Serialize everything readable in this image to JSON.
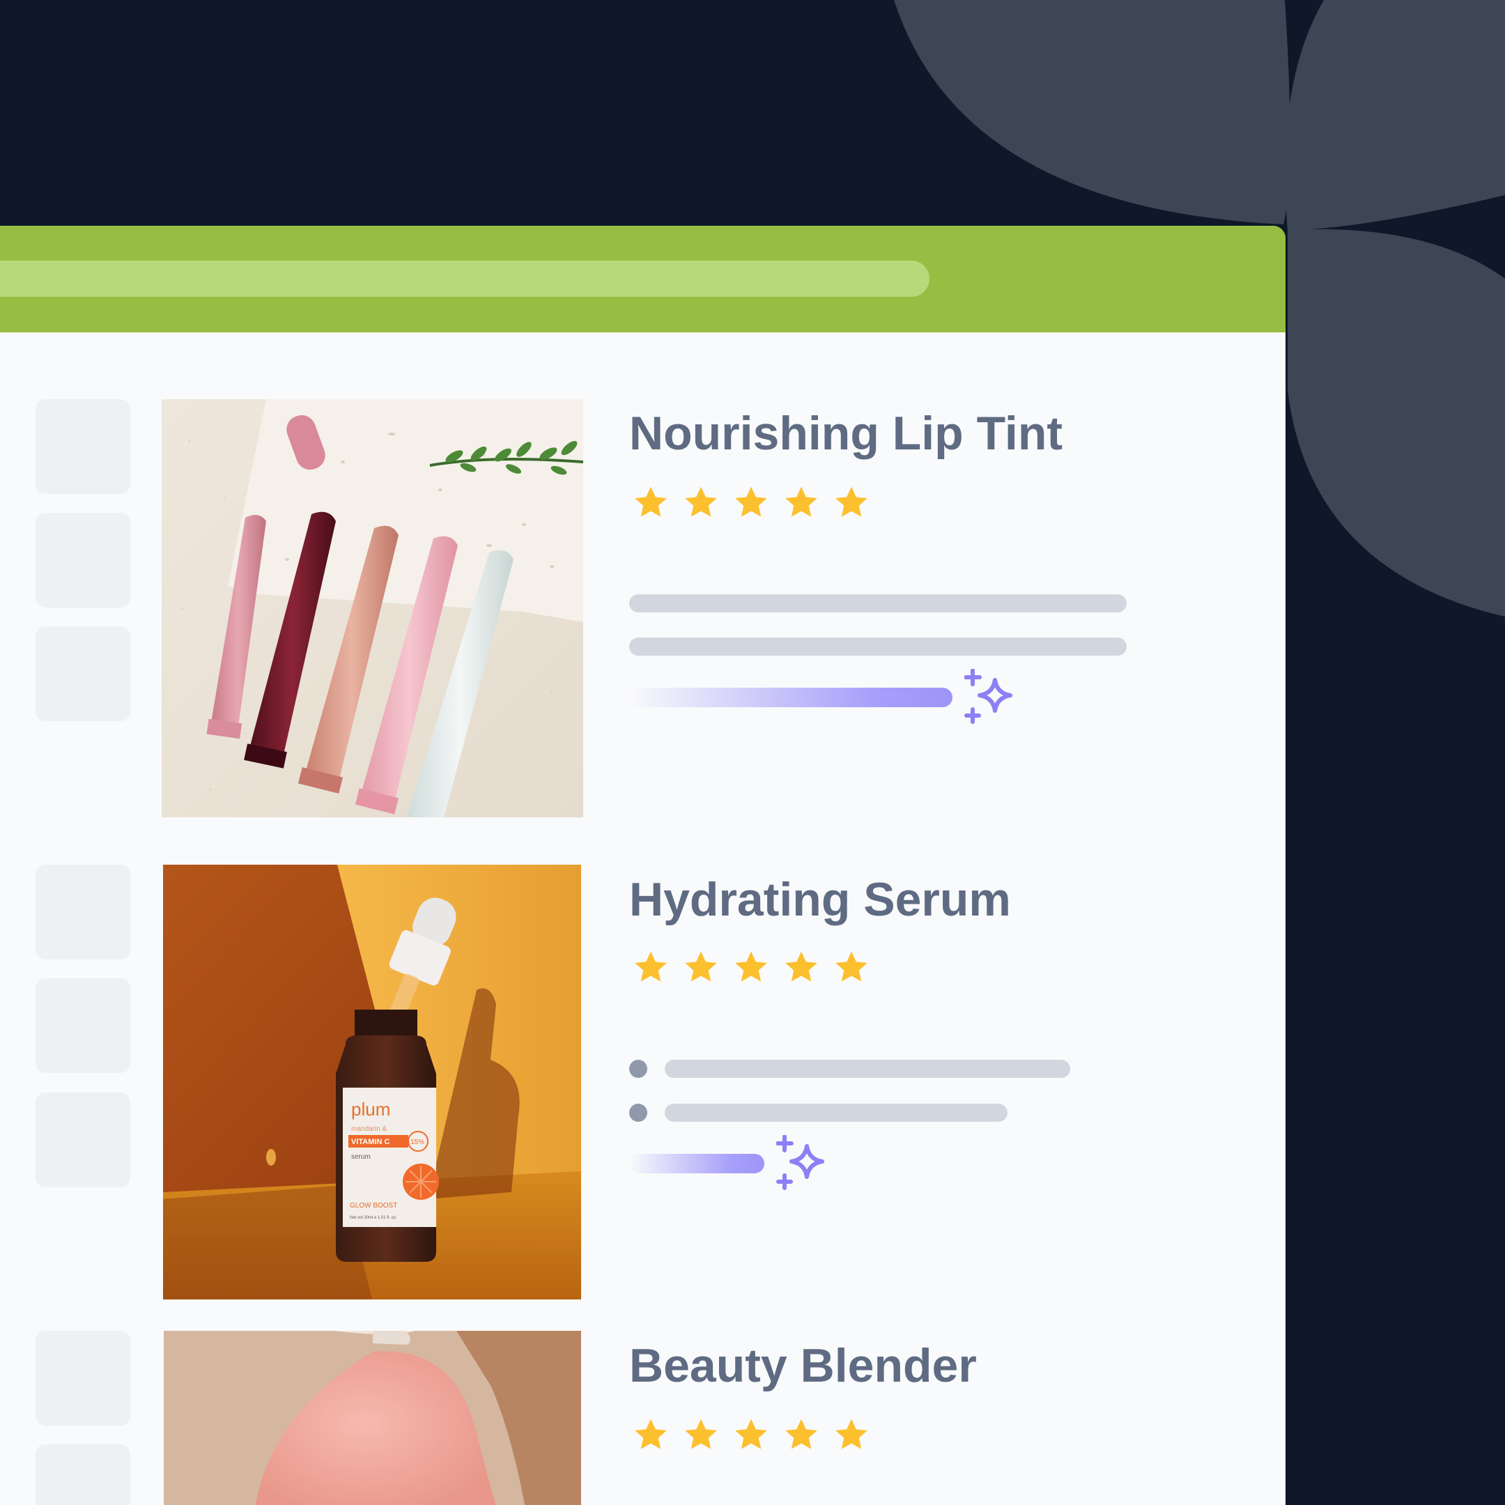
{
  "colors": {
    "background": "#0f1828",
    "petal": "#3d4655",
    "window": "#f9fafb",
    "topbar": "#97bd42",
    "addressbar": "#b8d97a",
    "title": "#5f6b82",
    "star": "#fcc02e",
    "ai_accent": "#8b80f5"
  },
  "products": [
    {
      "name": "Nourishing Lip Tint",
      "rating": 5,
      "image": "lip-tint-tubes-photo"
    },
    {
      "name": "Hydrating Serum",
      "rating": 5,
      "image": "serum-bottle-photo",
      "bottle_label": {
        "brand": "plum",
        "line1": "mandarin &",
        "badge": "VITAMIN C",
        "percent": "15%",
        "line3": "serum",
        "tag": "GLOW BOOST",
        "volume": "Net vol 30ml e 1.01 fl. oz."
      }
    },
    {
      "name": "Beauty Blender",
      "rating": 5,
      "image": "beauty-blender-photo"
    }
  ]
}
